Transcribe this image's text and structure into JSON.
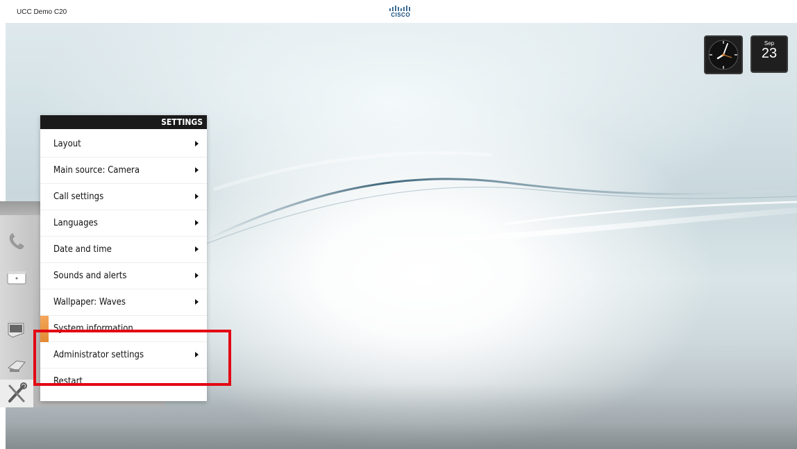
{
  "topbar": {
    "device_name": "UCC Demo C20",
    "brand": "CISCO"
  },
  "widgets": {
    "clock": {
      "icon": "analog-clock-icon"
    },
    "date": {
      "month": "Sep",
      "day": "23"
    }
  },
  "dock": {
    "items": [
      {
        "icon": "phone-icon"
      },
      {
        "icon": "directory-icon"
      },
      {
        "icon": "presentation-icon"
      },
      {
        "icon": "camera-icon"
      },
      {
        "icon": "settings-tools-icon",
        "selected": true
      }
    ]
  },
  "settings_menu": {
    "title": "SETTINGS",
    "items": [
      {
        "label": "Layout",
        "has_submenu": true
      },
      {
        "label": "Main source: Camera",
        "has_submenu": true
      },
      {
        "label": "Call settings",
        "has_submenu": true
      },
      {
        "label": "Languages",
        "has_submenu": true
      },
      {
        "label": "Date and time",
        "has_submenu": true
      },
      {
        "label": "Sounds and alerts",
        "has_submenu": true
      },
      {
        "label": "Wallpaper: Waves",
        "has_submenu": true
      },
      {
        "label": "System information",
        "has_submenu": false,
        "selected": true
      },
      {
        "label": "Administrator settings",
        "has_submenu": true
      },
      {
        "label": "Restart",
        "has_submenu": false
      }
    ]
  },
  "colors": {
    "accent": "#e28a33",
    "highlight": "#e30613",
    "menu_header": "#1a1a1a"
  }
}
